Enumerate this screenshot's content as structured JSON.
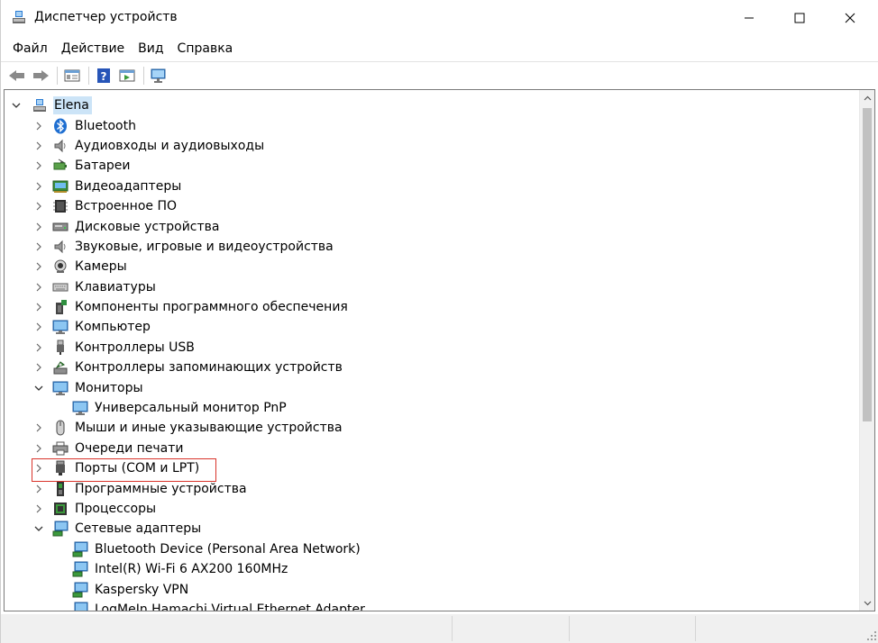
{
  "window": {
    "title": "Диспетчер устройств"
  },
  "menu": [
    "Файл",
    "Действие",
    "Вид",
    "Справка"
  ],
  "toolbar": [
    "back-icon",
    "forward-icon",
    "properties-icon",
    "help-icon",
    "update-driver-icon",
    "scan-hardware-icon"
  ],
  "tree": {
    "root": "Elena",
    "items": [
      {
        "label": "Bluetooth",
        "icon": "bluetooth-icon",
        "expanded": false
      },
      {
        "label": "Аудиовходы и аудиовыходы",
        "icon": "speaker-icon",
        "expanded": false
      },
      {
        "label": "Батареи",
        "icon": "battery-icon",
        "expanded": false
      },
      {
        "label": "Видеоадаптеры",
        "icon": "display-adapter-icon",
        "expanded": false
      },
      {
        "label": "Встроенное ПО",
        "icon": "firmware-icon",
        "expanded": false
      },
      {
        "label": "Дисковые устройства",
        "icon": "disk-icon",
        "expanded": false
      },
      {
        "label": "Звуковые, игровые и видеоустройства",
        "icon": "sound-icon",
        "expanded": false
      },
      {
        "label": "Камеры",
        "icon": "camera-icon",
        "expanded": false
      },
      {
        "label": "Клавиатуры",
        "icon": "keyboard-icon",
        "expanded": false
      },
      {
        "label": "Компоненты программного обеспечения",
        "icon": "software-component-icon",
        "expanded": false
      },
      {
        "label": "Компьютер",
        "icon": "computer-icon",
        "expanded": false
      },
      {
        "label": "Контроллеры USB",
        "icon": "usb-icon",
        "expanded": false
      },
      {
        "label": "Контроллеры запоминающих устройств",
        "icon": "storage-controller-icon",
        "expanded": false
      },
      {
        "label": "Мониторы",
        "icon": "monitor-icon",
        "expanded": true,
        "children": [
          {
            "label": "Универсальный монитор PnP",
            "icon": "monitor-icon"
          }
        ]
      },
      {
        "label": "Мыши и иные указывающие устройства",
        "icon": "mouse-icon",
        "expanded": false
      },
      {
        "label": "Очереди печати",
        "icon": "printer-icon",
        "expanded": false
      },
      {
        "label": "Порты (COM и LPT)",
        "icon": "port-icon",
        "expanded": false,
        "highlighted": true
      },
      {
        "label": "Программные устройства",
        "icon": "software-device-icon",
        "expanded": false
      },
      {
        "label": "Процессоры",
        "icon": "processor-icon",
        "expanded": false
      },
      {
        "label": "Сетевые адаптеры",
        "icon": "network-adapter-icon",
        "expanded": true,
        "children": [
          {
            "label": "Bluetooth Device (Personal Area Network)",
            "icon": "network-adapter-icon"
          },
          {
            "label": "Intel(R) Wi-Fi 6 AX200 160MHz",
            "icon": "network-adapter-icon"
          },
          {
            "label": "Kaspersky VPN",
            "icon": "network-adapter-icon"
          },
          {
            "label": "LogMeIn Hamachi Virtual Ethernet Adapter",
            "icon": "network-adapter-icon"
          }
        ]
      }
    ]
  },
  "colors": {
    "selection": "#cce4f7",
    "highlight_box": "#d9342b"
  }
}
